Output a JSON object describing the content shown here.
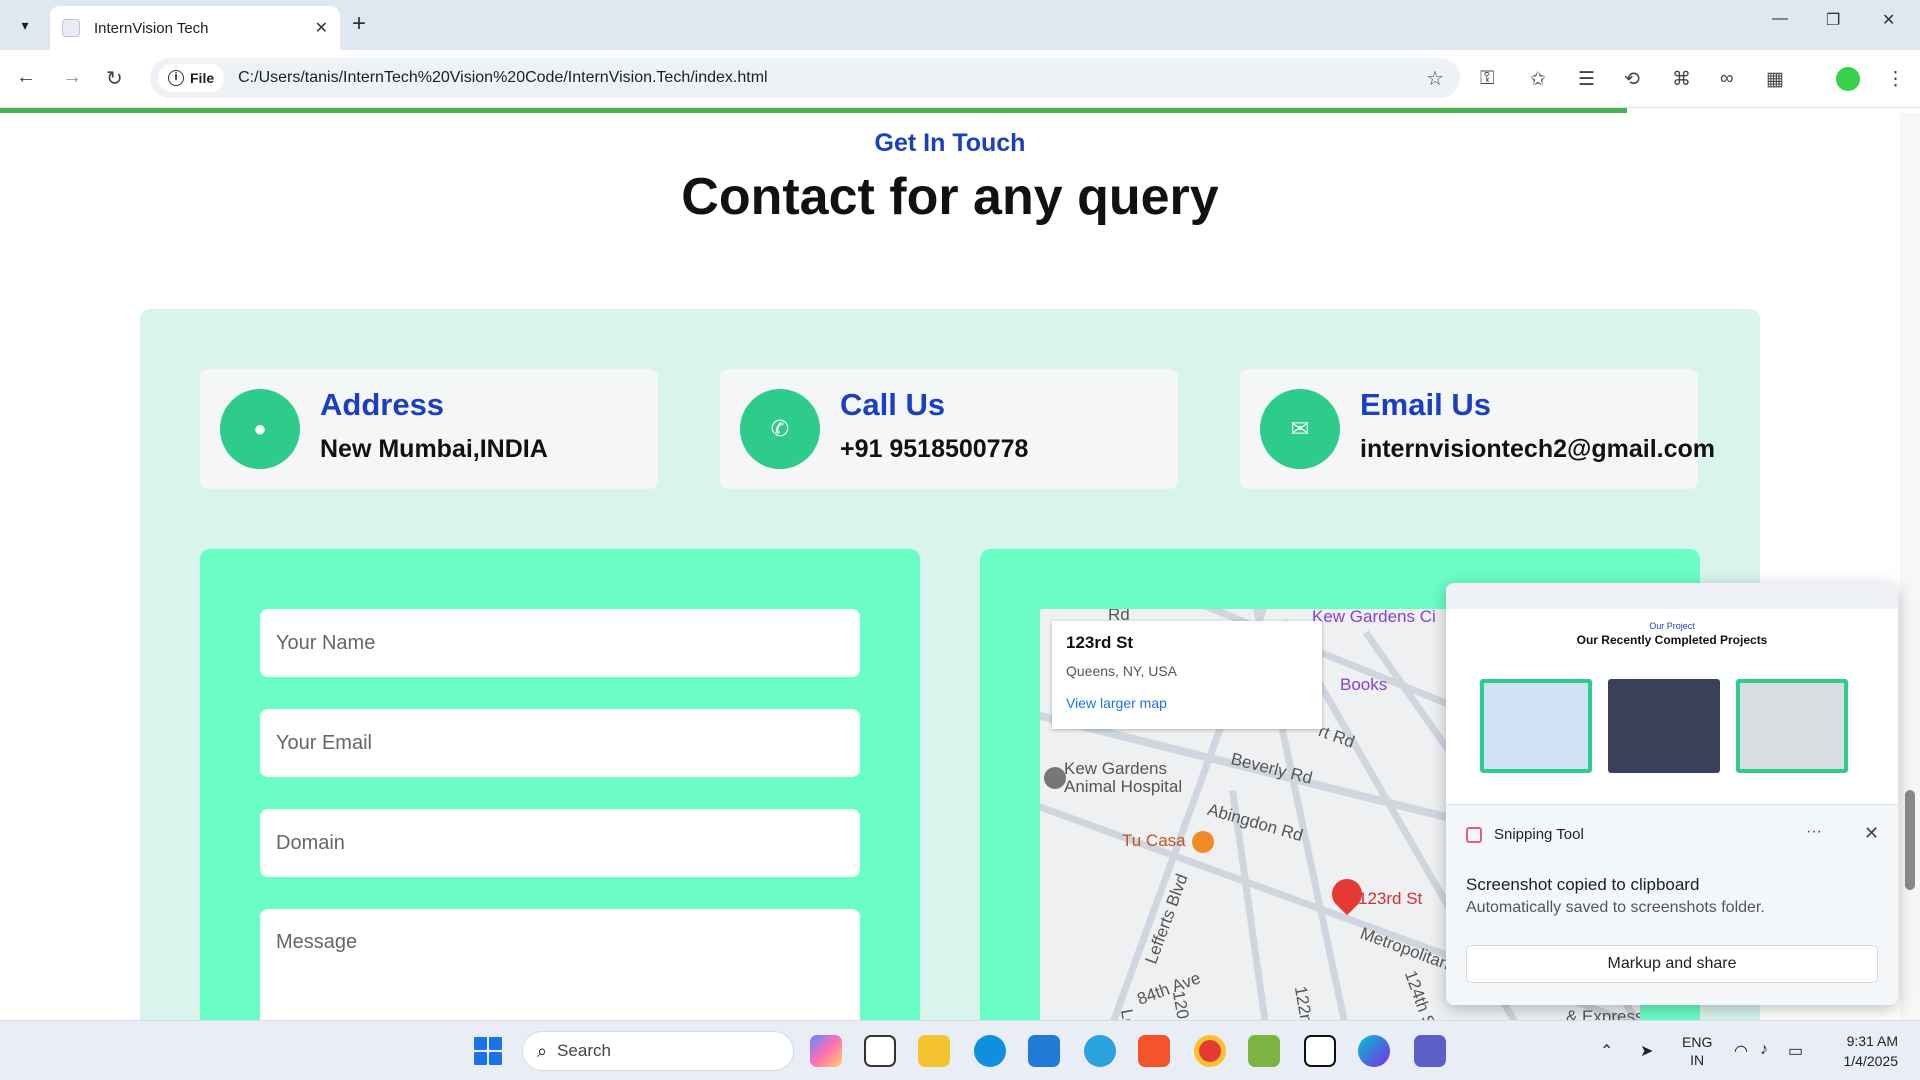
{
  "browser": {
    "tab_title": "InternVision Tech",
    "tab_close": "✕",
    "new_tab": "+",
    "address_chip": "File",
    "url": "C:/Users/tanis/InternTech%20Vision%20Code/InternVision.Tech/index.html"
  },
  "contact": {
    "kicker": "Get In Touch",
    "heading": "Contact for any query",
    "cards": [
      {
        "label": "Address",
        "value": "New Mumbai,INDIA",
        "icon": "location-pin-icon"
      },
      {
        "label": "Call Us",
        "value": "+91 9518500778",
        "icon": "phone-icon"
      },
      {
        "label": "Email Us",
        "value": "internvisiontech2@gmail.com",
        "icon": "mail-icon"
      }
    ],
    "form": {
      "name_placeholder": "Your Name",
      "email_placeholder": "Your Email",
      "domain_placeholder": "Domain",
      "message_placeholder": "Message"
    }
  },
  "map": {
    "card_title": "123rd St",
    "card_subtitle": "Queens, NY, USA",
    "card_link": "View larger map",
    "pin_label": "123rd St",
    "labels": [
      "Kew Gardens Ci",
      "Books",
      "Kew Gardens",
      "Animal Hospital",
      "Beverly Rd",
      "Abingdon Rd",
      "Tu Casa",
      "Lefferts Blvd",
      "Metropolitan",
      "84th Ave",
      "& Express",
      "Rd",
      "rt Rd",
      "124th S",
      "120",
      "122n",
      "Lef"
    ]
  },
  "snipping": {
    "app_name": "Snipping Tool",
    "dots": "···",
    "close": "✕",
    "message": "Screenshot copied to clipboard",
    "sub": "Automatically saved to screenshots folder.",
    "button": "Markup and share",
    "preview_kicker": "Our Project",
    "preview_title": "Our Recently Completed Projects"
  },
  "taskbar": {
    "search_placeholder": "Search",
    "lang_line1": "ENG",
    "lang_line2": "IN",
    "time": "9:31 AM",
    "date": "1/4/2025"
  },
  "colors": {
    "accent_blue": "#1a3fbf",
    "mint": "#6bfdc6",
    "green_icon": "#2ecc8a"
  }
}
